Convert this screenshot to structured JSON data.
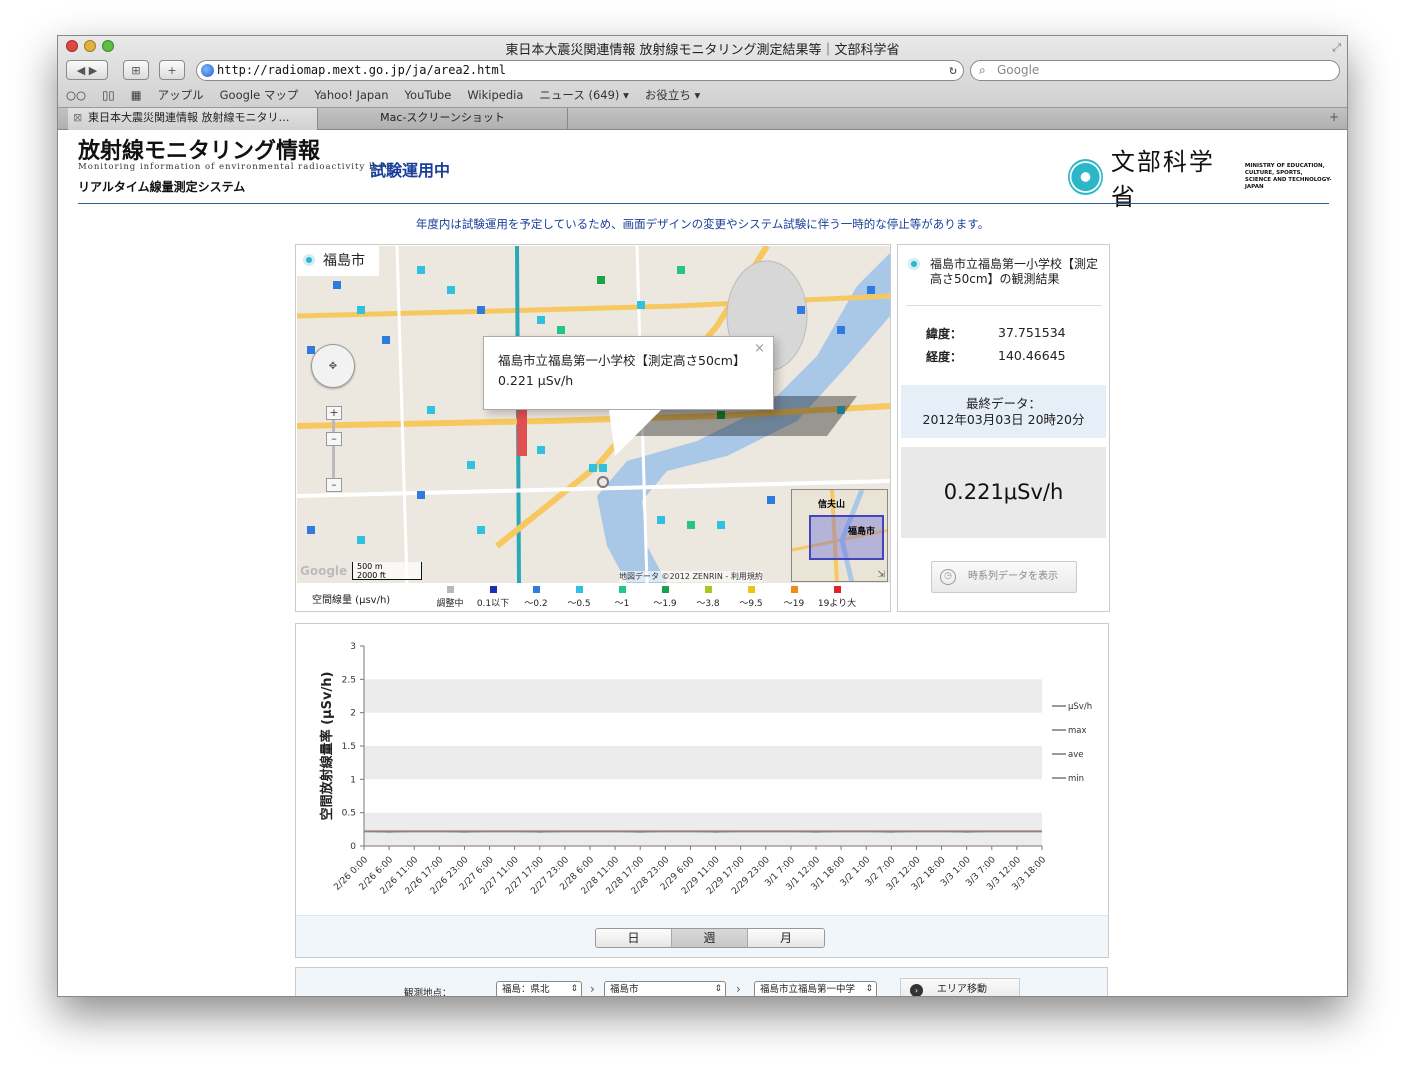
{
  "window": {
    "title": "東日本大震災関連情報 放射線モニタリング測定結果等｜文部科学省"
  },
  "browser": {
    "url": "http://radiomap.mext.go.jp/ja/area2.html",
    "search_placeholder": "Google",
    "bookmarks": [
      "アップル",
      "Google マップ",
      "Yahoo! Japan",
      "YouTube",
      "Wikipedia",
      "ニュース (649) ▾",
      "お役立ち ▾"
    ],
    "tabs": [
      "東日本大震災関連情報 放射線モニタリ…",
      "Mac-スクリーンショット"
    ]
  },
  "header": {
    "title": "放射線モニタリング情報",
    "subtitle": "Monitoring information of environmental radioactivity level",
    "system": "リアルタイム線量測定システム",
    "trial": "試験運用中",
    "ministry_name": "文部科学省",
    "ministry_en": [
      "MINISTRY OF EDUCATION,",
      "CULTURE, SPORTS,",
      "SCIENCE AND TECHNOLOGY-JAPAN"
    ]
  },
  "notice": "年度内は試験運用を予定しているため、画面デザインの変更やシステム試験に伴う一時的な停止等があります。",
  "map": {
    "city_label": "福島市",
    "popup_title": "福島市立福島第一小学校【測定高さ50cm】",
    "popup_value": "0.221 μSv/h",
    "inset_labels": [
      "信夫山",
      "福島市"
    ],
    "scale": [
      "500 m",
      "2000 ft"
    ],
    "credit": "地図データ ©2012 ZENRIN - 利用規約",
    "google": "Google",
    "legend_title": "空間線量 (μsv/h)",
    "legend": [
      {
        "label": "調整中",
        "color": "#b9b9b9"
      },
      {
        "label": "0.1以下",
        "color": "#1d2fb5"
      },
      {
        "label": "〜0.2",
        "color": "#2f7be0"
      },
      {
        "label": "〜0.5",
        "color": "#30c0e0"
      },
      {
        "label": "〜1",
        "color": "#24c48a"
      },
      {
        "label": "〜1.9",
        "color": "#19a24a"
      },
      {
        "label": "〜3.8",
        "color": "#a8c820"
      },
      {
        "label": "〜9.5",
        "color": "#f0c21a"
      },
      {
        "label": "〜19",
        "color": "#f08a1a"
      },
      {
        "label": "19より大",
        "color": "#e0242a"
      }
    ]
  },
  "info": {
    "station_title": "福島市立福島第一小学校【測定高さ50cm】の観測結果",
    "lat_label": "緯度：",
    "lat_value": "37.751534",
    "lon_label": "経度：",
    "lon_value": "140.46645",
    "last_data_label": "最終データ：",
    "last_data_time": "2012年03月03日 20時20分",
    "current_value": "0.221μSv/h",
    "history_button": "時系列データを表示"
  },
  "chart_data": {
    "type": "line",
    "ylabel": "空間放射線量率 (μSv/h)",
    "ylim": [
      0,
      3
    ],
    "yticks": [
      "0",
      "0.5",
      "1",
      "1.5",
      "2",
      "2.5",
      "3"
    ],
    "x": [
      "2/26 0:00",
      "2/26 6:00",
      "2/26 11:00",
      "2/26 17:00",
      "2/26 23:00",
      "2/27 6:00",
      "2/27 11:00",
      "2/27 17:00",
      "2/27 23:00",
      "2/28 6:00",
      "2/28 11:00",
      "2/28 17:00",
      "2/28 23:00",
      "2/29 6:00",
      "2/29 11:00",
      "2/29 17:00",
      "2/29 23:00",
      "3/1 7:00",
      "3/1 12:00",
      "3/1 18:00",
      "3/2 1:00",
      "3/2 7:00",
      "3/2 12:00",
      "3/2 18:00",
      "3/3 1:00",
      "3/3 7:00",
      "3/3 12:00",
      "3/3 18:00"
    ],
    "series": [
      {
        "name": "μSv/h",
        "color": "#2a4ca8",
        "values": [
          0.22,
          0.21,
          0.22,
          0.22,
          0.21,
          0.22,
          0.22,
          0.21,
          0.22,
          0.22,
          0.22,
          0.21,
          0.22,
          0.22,
          0.21,
          0.22,
          0.22,
          0.22,
          0.21,
          0.22,
          0.22,
          0.21,
          0.22,
          0.22,
          0.21,
          0.22,
          0.22,
          0.22
        ]
      },
      {
        "name": "max",
        "color": "#d08080",
        "values": [
          0.23,
          0.23,
          0.23,
          0.23,
          0.23,
          0.23,
          0.23,
          0.23,
          0.23,
          0.23,
          0.23,
          0.23,
          0.23,
          0.23,
          0.23,
          0.23,
          0.23,
          0.23,
          0.23,
          0.23,
          0.23,
          0.23,
          0.23,
          0.23,
          0.23,
          0.23,
          0.23,
          0.23
        ]
      },
      {
        "name": "ave",
        "color": "#888888",
        "values": [
          0.22,
          0.22,
          0.22,
          0.22,
          0.22,
          0.22,
          0.22,
          0.22,
          0.22,
          0.22,
          0.22,
          0.22,
          0.22,
          0.22,
          0.22,
          0.22,
          0.22,
          0.22,
          0.22,
          0.22,
          0.22,
          0.22,
          0.22,
          0.22,
          0.22,
          0.22,
          0.22,
          0.22
        ]
      },
      {
        "name": "min",
        "color": "#6aa06a",
        "values": [
          0.21,
          0.21,
          0.21,
          0.21,
          0.21,
          0.21,
          0.21,
          0.21,
          0.21,
          0.21,
          0.21,
          0.21,
          0.21,
          0.21,
          0.21,
          0.21,
          0.21,
          0.21,
          0.21,
          0.21,
          0.21,
          0.21,
          0.21,
          0.21,
          0.21,
          0.21,
          0.21,
          0.21
        ]
      }
    ],
    "legend_position": "right",
    "grid": "alternating bands"
  },
  "period": {
    "options": [
      "日",
      "週",
      "月"
    ],
    "selected": "週"
  },
  "station": {
    "label": "観測地点：",
    "prefecture": "福島：県北",
    "city": "福島市",
    "site": "福島市立福島第一中学",
    "area_button": "エリア移動"
  }
}
